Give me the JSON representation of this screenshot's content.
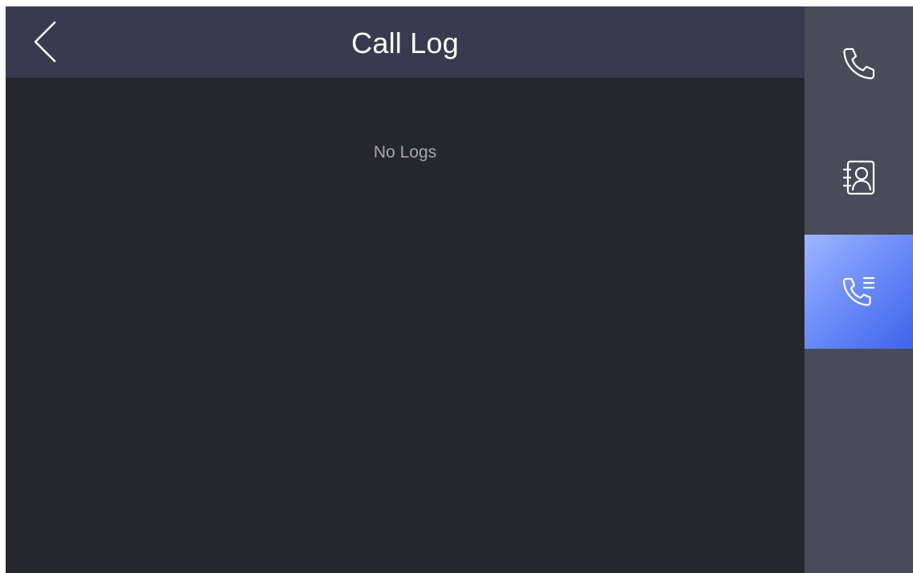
{
  "header": {
    "title": "Call Log",
    "back_icon": "chevron-left-icon"
  },
  "main": {
    "empty_message": "No Logs"
  },
  "sidebar": {
    "items": [
      {
        "id": "call",
        "icon": "phone-icon",
        "active": false
      },
      {
        "id": "contacts",
        "icon": "contacts-book-icon",
        "active": false
      },
      {
        "id": "call-log",
        "icon": "call-log-icon",
        "active": true
      }
    ],
    "active_gradient": [
      "#9fb6ff",
      "#3f63ec"
    ]
  },
  "colors": {
    "background": "#26262f",
    "header": "#393a4f",
    "sidebar": "#4a4b58",
    "title_text": "#ffffff",
    "muted_text": "#a6a7ad"
  }
}
